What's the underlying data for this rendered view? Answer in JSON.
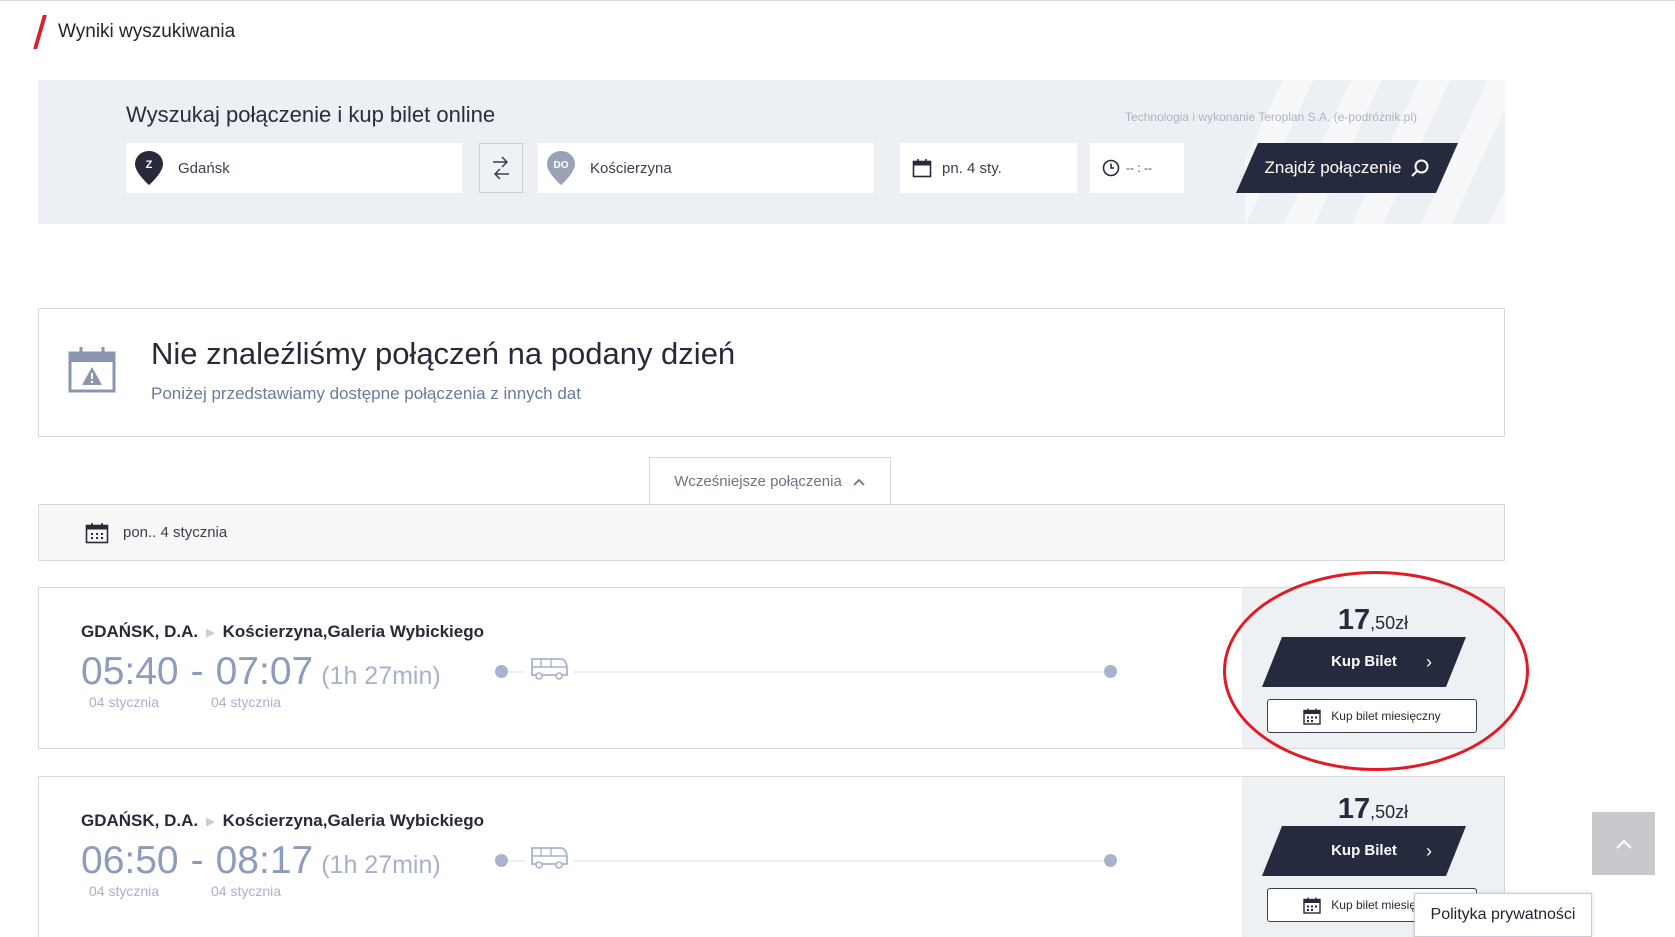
{
  "page": {
    "title": "Wyniki wyszukiwania"
  },
  "search": {
    "heading": "Wyszukaj połączenie i kup bilet online",
    "tech_note": "Technologia i wykonanie Teroplan S.A. (e-podróżnik.pl)",
    "from_badge": "Z",
    "from_value": "Gdańsk",
    "to_badge": "DO",
    "to_value": "Kościerzyna",
    "date_value": "pn. 4 sty.",
    "time_value": "-- : --",
    "find_label": "Znajdź połączenie"
  },
  "notice": {
    "title": "Nie znaleźliśmy połączeń na podany dzień",
    "subtitle": "Poniżej przedstawiamy dostępne połączenia z innych dat"
  },
  "earlier": {
    "label": "Wcześniejsze połączenia"
  },
  "date_bar": {
    "label": "pon.. 4 stycznia"
  },
  "results": [
    {
      "from": "GDAŃSK, D.A.",
      "to": "Kościerzyna,Galeria Wybickiego",
      "depart": "05:40",
      "arrive": "07:07",
      "duration": "(1h 27min)",
      "depart_date": "04 stycznia",
      "arrive_date": "04 stycznia",
      "price_int": "17",
      "price_frac": ",50zł",
      "buy_label": "Kup Bilet",
      "monthly_label": "Kup bilet miesięczny"
    },
    {
      "from": "GDAŃSK, D.A.",
      "to": "Kościerzyna,Galeria Wybickiego",
      "depart": "06:50",
      "arrive": "08:17",
      "duration": "(1h 27min)",
      "depart_date": "04 stycznia",
      "arrive_date": "04 stycznia",
      "price_int": "17",
      "price_frac": ",50zł",
      "buy_label": "Kup Bilet",
      "monthly_label": "Kup bilet miesięczny"
    }
  ],
  "privacy": {
    "label": "Polityka prywatności"
  },
  "colors": {
    "accent": "#d5222e",
    "button": "#252a3e",
    "highlight_ellipse": "#e01b24"
  }
}
